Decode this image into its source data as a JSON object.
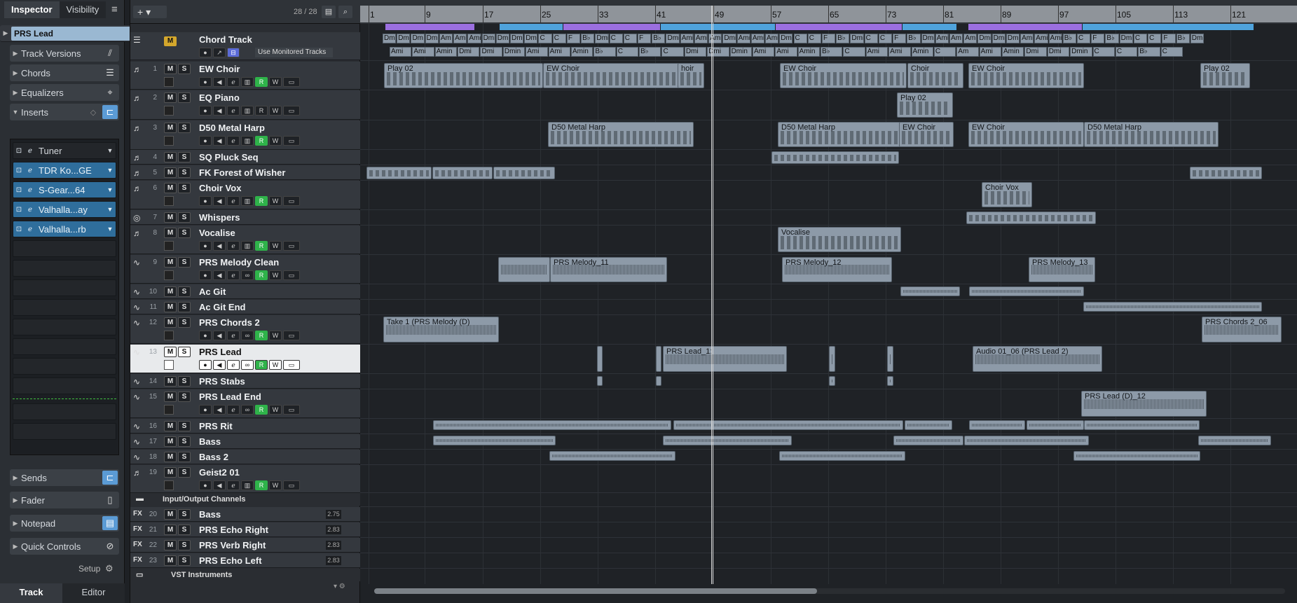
{
  "inspector": {
    "tabs": [
      "Inspector",
      "Visibility"
    ],
    "track_name": "PRS Lead",
    "sections": [
      "Track Versions",
      "Chords",
      "Equalizers",
      "Inserts",
      "Sends",
      "Fader",
      "Notepad",
      "Quick Controls"
    ],
    "inserts": [
      "Tuner",
      "TDR Ko...GE",
      "S-Gear...64",
      "Valhalla...ay",
      "Valhalla...rb"
    ],
    "setup_label": "Setup",
    "bottom_tabs": [
      "Track",
      "Editor"
    ]
  },
  "tracklist": {
    "count": "28 / 28",
    "chord_track": {
      "name": "Chord Track",
      "monitor_label": "Use Monitored Tracks"
    },
    "tracks": [
      {
        "num": "1",
        "name": "EW Choir"
      },
      {
        "num": "2",
        "name": "EQ Piano"
      },
      {
        "num": "3",
        "name": "D50 Metal Harp"
      },
      {
        "num": "4",
        "name": "SQ Pluck Seq"
      },
      {
        "num": "5",
        "name": "FK Forest of Wisher"
      },
      {
        "num": "6",
        "name": "Choir Vox"
      },
      {
        "num": "7",
        "name": "Whispers"
      },
      {
        "num": "8",
        "name": "Vocalise"
      },
      {
        "num": "9",
        "name": "PRS Melody Clean"
      },
      {
        "num": "10",
        "name": "Ac Git"
      },
      {
        "num": "11",
        "name": "Ac Git End"
      },
      {
        "num": "12",
        "name": "PRS Chords 2"
      },
      {
        "num": "13",
        "name": "PRS Lead"
      },
      {
        "num": "14",
        "name": "PRS Stabs"
      },
      {
        "num": "15",
        "name": "PRS Lead End"
      },
      {
        "num": "16",
        "name": "PRS Rit"
      },
      {
        "num": "17",
        "name": "Bass"
      },
      {
        "num": "18",
        "name": "Bass 2"
      },
      {
        "num": "19",
        "name": "Geist2 01"
      }
    ],
    "io_folder": "Input/Output Channels",
    "fx_tracks": [
      {
        "prefix": "FX",
        "num": "20",
        "name": "Bass",
        "value": "2.75"
      },
      {
        "prefix": "FX",
        "num": "21",
        "name": "PRS Echo Right",
        "value": "2.83"
      },
      {
        "prefix": "FX",
        "num": "22",
        "name": "PRS Verb Right",
        "value": "2.83"
      },
      {
        "prefix": "FX",
        "num": "23",
        "name": "PRS Echo Left",
        "value": "2.83"
      }
    ],
    "vst_folder": "VST Instruments"
  },
  "ruler": {
    "bars": [
      "1",
      "9",
      "17",
      "25",
      "33",
      "41",
      "49",
      "57",
      "65",
      "73",
      "81",
      "89",
      "97",
      "105",
      "113",
      "121"
    ]
  },
  "chords": {
    "row1": [
      "Dmi",
      "Dmi",
      "Dm",
      "Dmin",
      "Am",
      "Ami",
      "Ami",
      "Dmi",
      "Dmi",
      "Dmi",
      "Dmin",
      "C",
      "C",
      "F",
      "B♭",
      "Dmin",
      "C",
      "C",
      "F",
      "B♭",
      "Dmin",
      "Ami",
      "Ami",
      "Ami",
      "Dmin",
      "Ami",
      "Ami",
      "Ami",
      "Dmin",
      "C",
      "C",
      "F",
      "B♭",
      "Dmin",
      "C",
      "C",
      "F",
      "B♭",
      "Dmin",
      "Ami",
      "Am",
      "Amin",
      "Dmi",
      "Dmi",
      "Dmin",
      "Ami",
      "Ami",
      "Amin",
      "B♭",
      "C",
      "F",
      "B♭",
      "Dmin",
      "C",
      "C",
      "F",
      "B♭",
      "Dmin"
    ],
    "row2": [
      "Ami",
      "Ami",
      "Amin",
      "Dmi",
      "Dmi",
      "Dmin",
      "Ami",
      "Ami",
      "Amin",
      "B♭",
      "C",
      "B♭",
      "C",
      "Dmi",
      "Dmi",
      "Dmin",
      "Ami",
      "Ami",
      "Amin",
      "B♭",
      "C",
      "Ami",
      "Ami",
      "Amin",
      "C",
      "Am",
      "Ami",
      "Amin",
      "Dmi",
      "Dmi",
      "Dmin",
      "C",
      "C",
      "B♭",
      "C"
    ]
  },
  "parts": {
    "play02_a": "Play 02",
    "ew_choir_a": "EW Choir",
    "hoir": "hoir",
    "ew_choir_b": "EW Choir",
    "choir_c": "Choir",
    "ew_choir_d": "EW Choir",
    "play02_b": "Play 02",
    "play02_c": "Play 02",
    "d50_a": "D50 Metal Harp",
    "d50_b": "D50 Metal Harp",
    "ew_choir_e": "EW Choir",
    "ew_choir_f": "EW Choir",
    "d50_c": "D50 Metal Harp",
    "choir_vox": "Choir Vox",
    "vocalise": "Vocalise",
    "prs_melody_11": "PRS Melody_11",
    "prs_melody_12": "PRS Melody_12",
    "prs_melody_13": "PRS Melody_13",
    "take1": "Take 1 (PRS Melody (D)",
    "prs_chords_06": "PRS Chords 2_06",
    "prs_lead_1": "PRS Lead_1:",
    "audio01_06": "Audio 01_06 (PRS Lead 2)",
    "prs_lead_d12": "PRS Lead (D)_12"
  },
  "colors": {
    "accent": "#5b9bd5",
    "record_green": "#2fb34a",
    "chord_purple": "#9b6fe0",
    "chord_blue": "#4fa3dc",
    "part": "#8d9aa8"
  }
}
